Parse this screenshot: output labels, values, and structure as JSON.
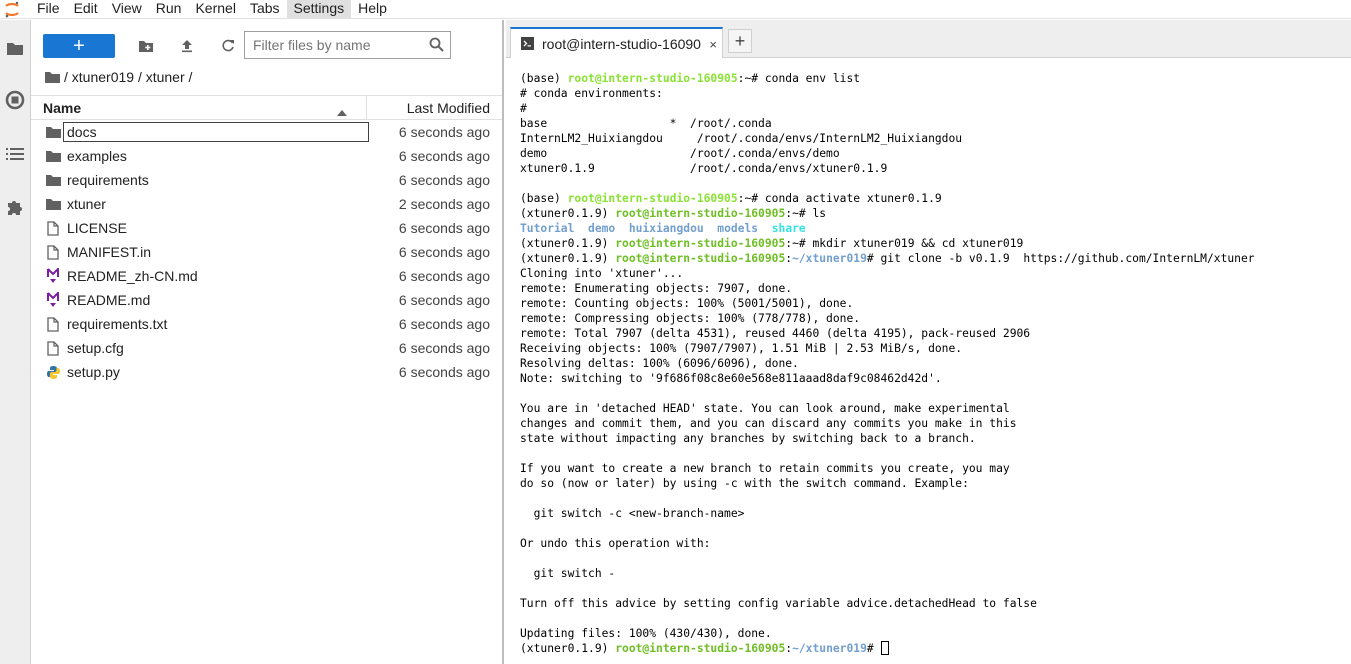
{
  "menubar": {
    "items": [
      "File",
      "Edit",
      "View",
      "Run",
      "Kernel",
      "Tabs",
      "Settings",
      "Help"
    ],
    "active": "Settings"
  },
  "filebrowser": {
    "new_label": "+",
    "filter_placeholder": "Filter files by name",
    "breadcrumb": "/ xtuner019 / xtuner /",
    "col_name": "Name",
    "col_modified": "Last Modified",
    "files": [
      {
        "name": "docs",
        "type": "folder",
        "modified": "6 seconds ago"
      },
      {
        "name": "examples",
        "type": "folder",
        "modified": "6 seconds ago"
      },
      {
        "name": "requirements",
        "type": "folder",
        "modified": "6 seconds ago"
      },
      {
        "name": "xtuner",
        "type": "folder",
        "modified": "2 seconds ago"
      },
      {
        "name": "LICENSE",
        "type": "file",
        "modified": "6 seconds ago"
      },
      {
        "name": "MANIFEST.in",
        "type": "file",
        "modified": "6 seconds ago"
      },
      {
        "name": "README_zh-CN.md",
        "type": "markdown",
        "modified": "6 seconds ago"
      },
      {
        "name": "README.md",
        "type": "markdown",
        "modified": "6 seconds ago"
      },
      {
        "name": "requirements.txt",
        "type": "file",
        "modified": "6 seconds ago"
      },
      {
        "name": "setup.cfg",
        "type": "file",
        "modified": "6 seconds ago"
      },
      {
        "name": "setup.py",
        "type": "python",
        "modified": "6 seconds ago"
      }
    ]
  },
  "terminal": {
    "tab_title": "root@intern-studio-16090",
    "tab_close": "×",
    "add_tab": "+",
    "lines": [
      {
        "parts": [
          {
            "t": "(base) ",
            "s": ""
          },
          {
            "t": "root@intern-studio-160905",
            "s": "g"
          },
          {
            "t": ":~# conda env list",
            "s": ""
          }
        ]
      },
      {
        "parts": [
          {
            "t": "# conda environments:",
            "s": ""
          }
        ]
      },
      {
        "parts": [
          {
            "t": "#",
            "s": ""
          }
        ]
      },
      {
        "parts": [
          {
            "t": "base                  *  /root/.conda",
            "s": ""
          }
        ]
      },
      {
        "parts": [
          {
            "t": "InternLM2_Huixiangdou     /root/.conda/envs/InternLM2_Huixiangdou",
            "s": ""
          }
        ]
      },
      {
        "parts": [
          {
            "t": "demo                     /root/.conda/envs/demo",
            "s": ""
          }
        ]
      },
      {
        "parts": [
          {
            "t": "xtuner0.1.9              /root/.conda/envs/xtuner0.1.9",
            "s": ""
          }
        ]
      },
      {
        "parts": [
          {
            "t": "",
            "s": ""
          }
        ]
      },
      {
        "parts": [
          {
            "t": "(base) ",
            "s": ""
          },
          {
            "t": "root@intern-studio-160905",
            "s": "g"
          },
          {
            "t": ":~# conda activate xtuner0.1.9",
            "s": ""
          }
        ]
      },
      {
        "parts": [
          {
            "t": "(xtuner0.1.9) ",
            "s": ""
          },
          {
            "t": "root@intern-studio-160905",
            "s": "g2"
          },
          {
            "t": ":~# ls",
            "s": ""
          }
        ]
      },
      {
        "parts": [
          {
            "t": "Tutorial",
            "s": "b"
          },
          {
            "t": "  ",
            "s": ""
          },
          {
            "t": "demo",
            "s": "b"
          },
          {
            "t": "  ",
            "s": ""
          },
          {
            "t": "huixiangdou",
            "s": "b"
          },
          {
            "t": "  ",
            "s": ""
          },
          {
            "t": "models",
            "s": "b"
          },
          {
            "t": "  ",
            "s": ""
          },
          {
            "t": "share",
            "s": "c"
          }
        ]
      },
      {
        "parts": [
          {
            "t": "(xtuner0.1.9) ",
            "s": ""
          },
          {
            "t": "root@intern-studio-160905",
            "s": "g2"
          },
          {
            "t": ":~# mkdir xtuner019 && cd xtuner019",
            "s": ""
          }
        ]
      },
      {
        "parts": [
          {
            "t": "(xtuner0.1.9) ",
            "s": ""
          },
          {
            "t": "root@intern-studio-160905",
            "s": "g2"
          },
          {
            "t": ":",
            "s": ""
          },
          {
            "t": "~/xtuner019",
            "s": "b"
          },
          {
            "t": "# git clone -b v0.1.9  https://github.com/InternLM/xtuner",
            "s": ""
          }
        ]
      },
      {
        "parts": [
          {
            "t": "Cloning into 'xtuner'...",
            "s": ""
          }
        ]
      },
      {
        "parts": [
          {
            "t": "remote: Enumerating objects: 7907, done.",
            "s": ""
          }
        ]
      },
      {
        "parts": [
          {
            "t": "remote: Counting objects: 100% (5001/5001), done.",
            "s": ""
          }
        ]
      },
      {
        "parts": [
          {
            "t": "remote: Compressing objects: 100% (778/778), done.",
            "s": ""
          }
        ]
      },
      {
        "parts": [
          {
            "t": "remote: Total 7907 (delta 4531), reused 4460 (delta 4195), pack-reused 2906",
            "s": ""
          }
        ]
      },
      {
        "parts": [
          {
            "t": "Receiving objects: 100% (7907/7907), 1.51 MiB | 2.53 MiB/s, done.",
            "s": ""
          }
        ]
      },
      {
        "parts": [
          {
            "t": "Resolving deltas: 100% (6096/6096), done.",
            "s": ""
          }
        ]
      },
      {
        "parts": [
          {
            "t": "Note: switching to '9f686f08c8e60e568e811aaad8daf9c08462d42d'.",
            "s": ""
          }
        ]
      },
      {
        "parts": [
          {
            "t": "",
            "s": ""
          }
        ]
      },
      {
        "parts": [
          {
            "t": "You are in 'detached HEAD' state. You can look around, make experimental",
            "s": ""
          }
        ]
      },
      {
        "parts": [
          {
            "t": "changes and commit them, and you can discard any commits you make in this",
            "s": ""
          }
        ]
      },
      {
        "parts": [
          {
            "t": "state without impacting any branches by switching back to a branch.",
            "s": ""
          }
        ]
      },
      {
        "parts": [
          {
            "t": "",
            "s": ""
          }
        ]
      },
      {
        "parts": [
          {
            "t": "If you want to create a new branch to retain commits you create, you may",
            "s": ""
          }
        ]
      },
      {
        "parts": [
          {
            "t": "do so (now or later) by using -c with the switch command. Example:",
            "s": ""
          }
        ]
      },
      {
        "parts": [
          {
            "t": "",
            "s": ""
          }
        ]
      },
      {
        "parts": [
          {
            "t": "  git switch -c <new-branch-name>",
            "s": ""
          }
        ]
      },
      {
        "parts": [
          {
            "t": "",
            "s": ""
          }
        ]
      },
      {
        "parts": [
          {
            "t": "Or undo this operation with:",
            "s": ""
          }
        ]
      },
      {
        "parts": [
          {
            "t": "",
            "s": ""
          }
        ]
      },
      {
        "parts": [
          {
            "t": "  git switch -",
            "s": ""
          }
        ]
      },
      {
        "parts": [
          {
            "t": "",
            "s": ""
          }
        ]
      },
      {
        "parts": [
          {
            "t": "Turn off this advice by setting config variable advice.detachedHead to false",
            "s": ""
          }
        ]
      },
      {
        "parts": [
          {
            "t": "",
            "s": ""
          }
        ]
      },
      {
        "parts": [
          {
            "t": "Updating files: 100% (430/430), done.",
            "s": ""
          }
        ]
      },
      {
        "parts": [
          {
            "t": "(xtuner0.1.9) ",
            "s": ""
          },
          {
            "t": "root@intern-studio-160905",
            "s": "g2"
          },
          {
            "t": ":",
            "s": ""
          },
          {
            "t": "~/xtuner019",
            "s": "b"
          },
          {
            "t": "# ",
            "s": ""
          }
        ],
        "cursor": true
      }
    ]
  },
  "colors": {
    "accent": "#1976d2",
    "prompt_green": "#8ae234",
    "dir_blue": "#729fcf",
    "link_cyan": "#34e2e2",
    "folder_icon": "#616161",
    "markdown_icon": "#7b1fa2"
  },
  "icons": {
    "logo": "jupyter-logo-icon",
    "folder_tab": "folder-icon",
    "running": "stop-circle-icon",
    "toc": "list-icon",
    "extensions": "puzzle-icon",
    "new_folder": "new-folder-icon",
    "upload": "upload-icon",
    "refresh": "refresh-icon",
    "search": "search-icon"
  }
}
